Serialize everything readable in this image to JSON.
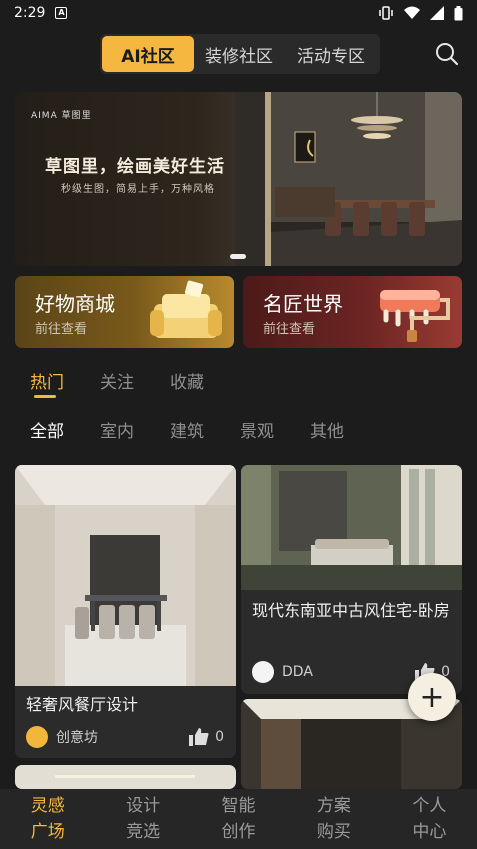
{
  "status_bar": {
    "time": "2:29"
  },
  "top_tabs": [
    {
      "label": "AI社区"
    },
    {
      "label": "装修社区"
    },
    {
      "label": "活动专区"
    }
  ],
  "banner": {
    "logo_text": "AIMA 草图里",
    "headline": "草图里，绘画美好生活",
    "subline": "秒级生图，简易上手，万种风格"
  },
  "promos": [
    {
      "title": "好物商城",
      "subtitle": "前往查看"
    },
    {
      "title": "名匠世界",
      "subtitle": "前往查看"
    }
  ],
  "feed_tabs": [
    {
      "label": "热门"
    },
    {
      "label": "关注"
    },
    {
      "label": "收藏"
    }
  ],
  "category_tabs": [
    {
      "label": "全部"
    },
    {
      "label": "室内"
    },
    {
      "label": "建筑"
    },
    {
      "label": "景观"
    },
    {
      "label": "其他"
    }
  ],
  "cards": [
    {
      "title": "轻奢风餐厅设计",
      "author": "创意坊",
      "likes": "0"
    },
    {
      "title": "现代东南亚中古风住宅-卧房",
      "author": "DDA",
      "likes": "0"
    }
  ],
  "fab": {
    "label": "+"
  },
  "bottom_nav": [
    {
      "line1": "灵感",
      "line2": "广场"
    },
    {
      "line1": "设计",
      "line2": "竞选"
    },
    {
      "line1": "智能",
      "line2": "创作"
    },
    {
      "line1": "方案",
      "line2": "购买"
    },
    {
      "line1": "个人",
      "line2": "中心"
    }
  ],
  "colors": {
    "accent": "#f5b740",
    "background": "#1c1c1c",
    "card": "#2b2b2b"
  },
  "icons": [
    "search-icon",
    "thumbs-up-icon",
    "plus-icon",
    "wifi-icon",
    "battery-icon",
    "vibrate-icon"
  ]
}
